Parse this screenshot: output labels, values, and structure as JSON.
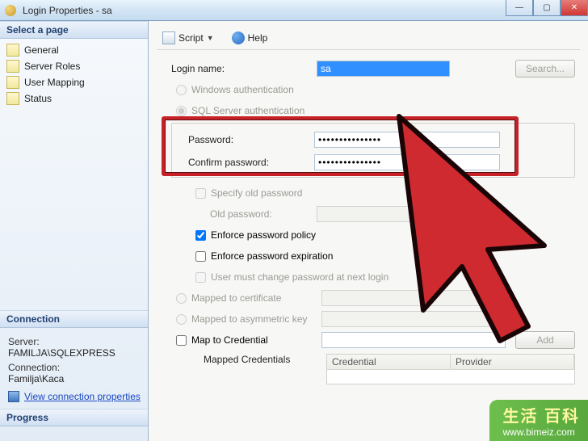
{
  "window": {
    "title": "Login Properties - sa"
  },
  "winbtns": {
    "min": "—",
    "max": "▢",
    "close": "✕"
  },
  "sidebar": {
    "select_page": "Select a page",
    "items": [
      {
        "label": "General"
      },
      {
        "label": "Server Roles"
      },
      {
        "label": "User Mapping"
      },
      {
        "label": "Status"
      }
    ]
  },
  "connection": {
    "heading": "Connection",
    "server_label": "Server:",
    "server_value": "FAMILJA\\SQLEXPRESS",
    "conn_label": "Connection:",
    "conn_value": "Familja\\Kaca",
    "view_link": "View connection properties"
  },
  "progress": {
    "heading": "Progress"
  },
  "toolbar": {
    "script": "Script",
    "help": "Help"
  },
  "form": {
    "login_name_label": "Login name:",
    "login_name_value": "sa",
    "search_btn": "Search...",
    "auth_win": "Windows authentication",
    "auth_sql": "SQL Server authentication",
    "password_label": "Password:",
    "password_value": "•••••••••••••••",
    "confirm_label": "Confirm password:",
    "confirm_value": "•••••••••••••••",
    "specify_old": "Specify old password",
    "old_pw_label": "Old password:",
    "enforce_policy": "Enforce password policy",
    "enforce_expiry": "Enforce password expiration",
    "must_change": "User must change password at next login",
    "mapped_cert": "Mapped to certificate",
    "mapped_asym": "Mapped to asymmetric key",
    "map_cred": "Map to Credential",
    "add_btn": "Add",
    "mapped_credentials": "Mapped Credentials",
    "grid_col1": "Credential",
    "grid_col2": "Provider"
  },
  "watermark": {
    "big": "生活 百科",
    "url": "www.bimeiz.com"
  }
}
